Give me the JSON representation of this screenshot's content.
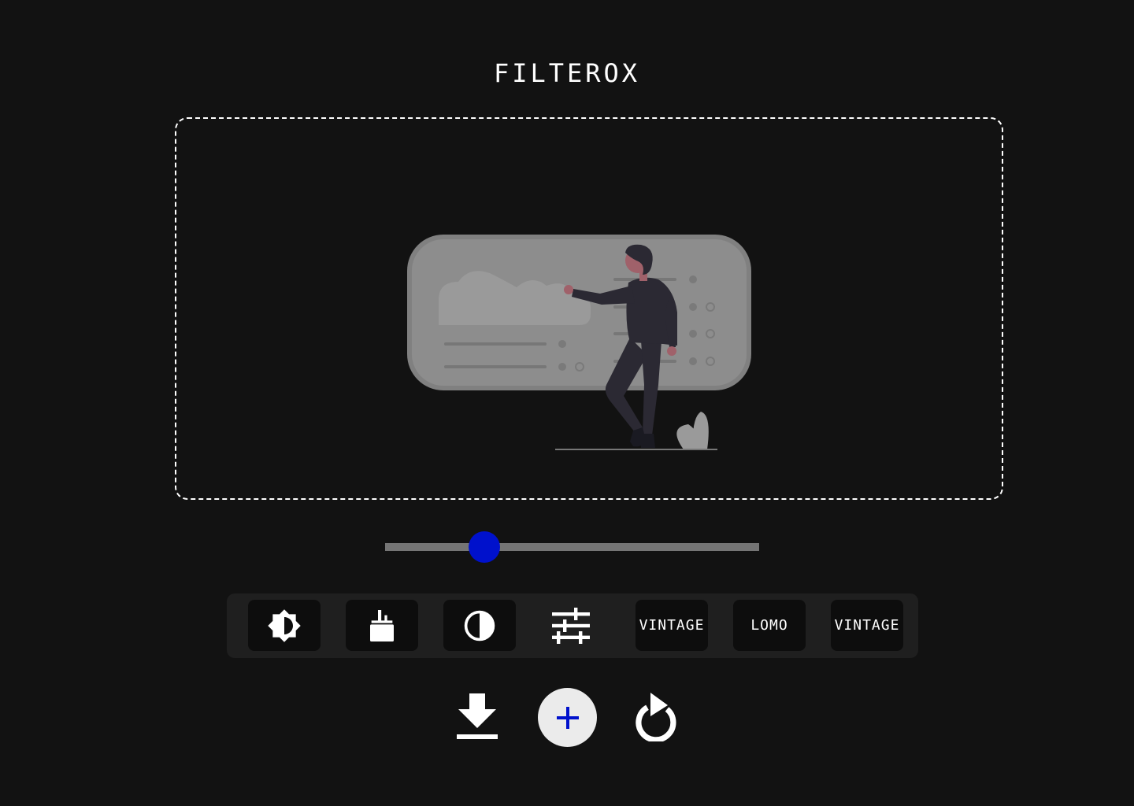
{
  "app": {
    "title": "FILTEROX"
  },
  "slider": {
    "value_fraction": 0.265
  },
  "filters": [
    {
      "kind": "icon",
      "icon": "brightness-icon"
    },
    {
      "kind": "icon",
      "icon": "paint-bucket-icon"
    },
    {
      "kind": "icon",
      "icon": "contrast-icon"
    },
    {
      "kind": "icon",
      "icon": "sliders-icon"
    },
    {
      "kind": "text",
      "label": "VINTAGE"
    },
    {
      "kind": "text",
      "label": "LOMO"
    },
    {
      "kind": "text",
      "label": "VINTAGE"
    }
  ],
  "actions": {
    "download_icon": "download-icon",
    "add_icon": "plus-icon",
    "reset_icon": "refresh-icon"
  },
  "colors": {
    "background": "#121212",
    "accent": "#0011cc",
    "toolbar": "#1f1f1f",
    "tool_button": "#0d0d0d",
    "slider_track": "#757575"
  }
}
